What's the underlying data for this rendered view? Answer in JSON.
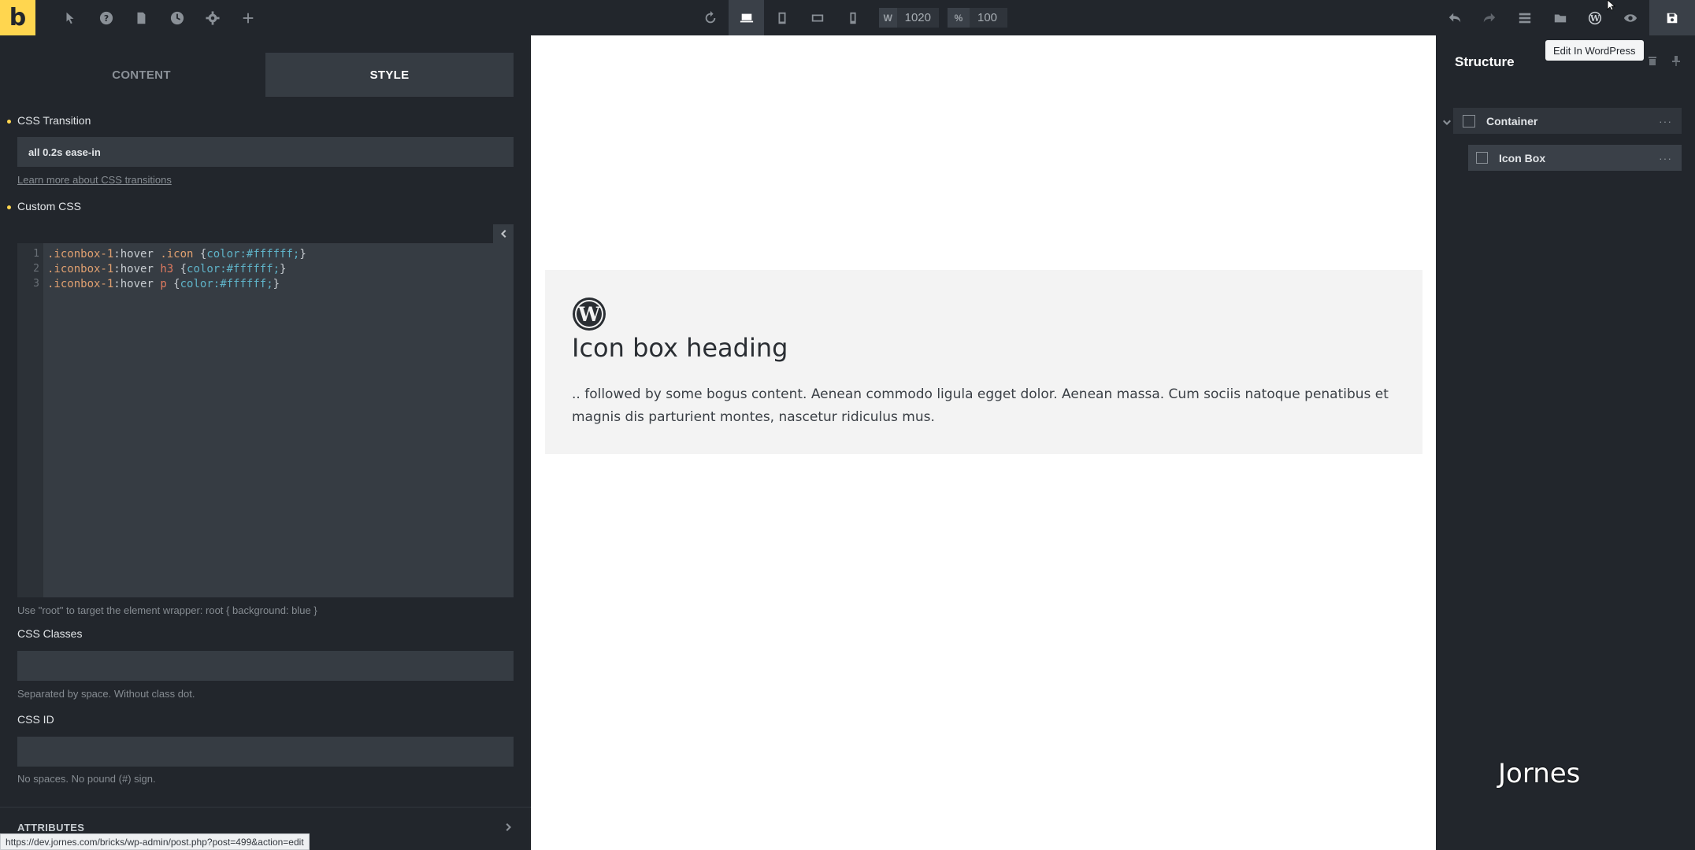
{
  "toolbar": {
    "logo": "b",
    "icons_left": [
      "pointer-icon",
      "help-icon",
      "pages-icon",
      "history-icon",
      "settings-icon",
      "add-icon"
    ],
    "icons_center": [
      "refresh-icon",
      "desktop-icon",
      "tablet-portrait-icon",
      "tablet-landscape-icon",
      "mobile-icon"
    ],
    "width_label": "W",
    "width_value": "1020",
    "zoom_label": "%",
    "zoom_value": "100",
    "icons_right": [
      "undo-icon",
      "redo-icon",
      "layers-icon",
      "folder-icon",
      "wordpress-icon",
      "preview-icon",
      "save-icon"
    ]
  },
  "left_panel": {
    "tabs": {
      "content": "CONTENT",
      "style": "STYLE"
    },
    "css_transition": {
      "label": "CSS Transition",
      "value": "all 0.2s ease-in",
      "help": "Learn more about CSS transitions"
    },
    "custom_css": {
      "label": "Custom CSS",
      "lines": [
        {
          "num": "1",
          "sel": ".iconbox-1",
          "pseudo": ":hover ",
          "tag": ".icon",
          "rule_open": " {",
          "prop": "color",
          "val": ":#ffffff;",
          "close": "}"
        },
        {
          "num": "2",
          "sel": ".iconbox-1",
          "pseudo": ":hover ",
          "tag": "h3",
          "rule_open": " {",
          "prop": "color",
          "val": ":#ffffff;",
          "close": "}"
        },
        {
          "num": "3",
          "sel": ".iconbox-1",
          "pseudo": ":hover ",
          "tag": "p",
          "rule_open": " {",
          "prop": "color",
          "val": ":#ffffff;",
          "close": "}"
        }
      ],
      "help": "Use \"root\" to target the element wrapper: root { background: blue }"
    },
    "css_classes": {
      "label": "CSS Classes",
      "value": "",
      "help": "Separated by space. Without class dot."
    },
    "css_id": {
      "label": "CSS ID",
      "value": "",
      "help": "No spaces. No pound (#) sign."
    },
    "attributes_label": "ATTRIBUTES",
    "status_url": "https://dev.jornes.com/bricks/wp-admin/post.php?post=499&action=edit"
  },
  "canvas": {
    "iconbox": {
      "heading": "Icon box heading",
      "text": ".. followed by some bogus content. Aenean commodo ligula egget dolor. Aenean massa. Cum sociis natoque penatibus et magnis dis parturient montes, nascetur ridiculus mus."
    }
  },
  "structure": {
    "title": "Structure",
    "tooltip": "Edit In WordPress",
    "items": [
      {
        "name": "Container"
      },
      {
        "name": "Icon Box"
      }
    ]
  },
  "watermark": "Jornes",
  "colors": {
    "accent": "#ffd64f",
    "panel": "#22262c",
    "input": "#363c43"
  }
}
